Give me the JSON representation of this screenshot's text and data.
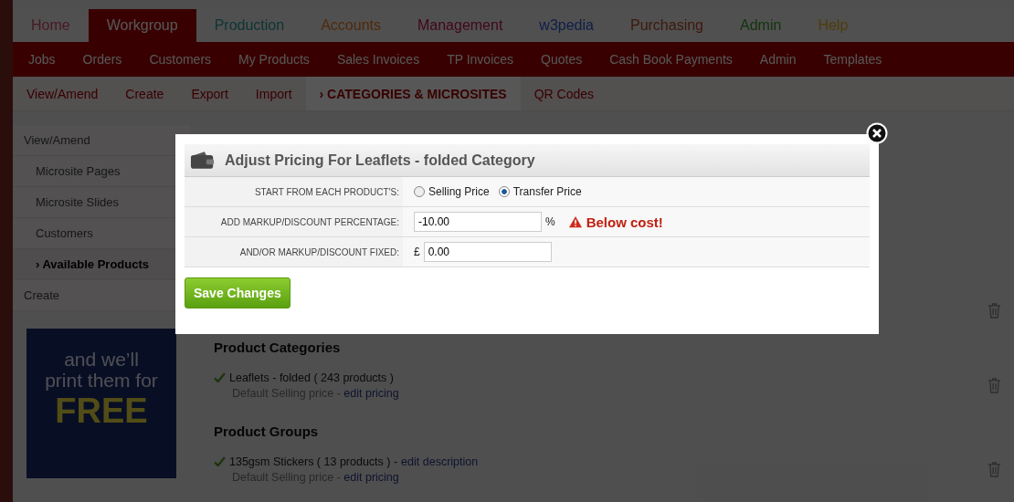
{
  "main_nav": [
    {
      "label": "Home",
      "selected": false
    },
    {
      "label": "Workgroup",
      "selected": true
    },
    {
      "label": "Production",
      "selected": false
    },
    {
      "label": "Accounts",
      "selected": false
    },
    {
      "label": "Management",
      "selected": false
    },
    {
      "label": "w3pedia",
      "selected": false
    },
    {
      "label": "Purchasing",
      "selected": false
    },
    {
      "label": "Admin",
      "selected": false
    },
    {
      "label": "Help",
      "selected": false
    }
  ],
  "sub_nav": [
    "Jobs",
    "Orders",
    "Customers",
    "My Products",
    "Sales Invoices",
    "TP Invoices",
    "Quotes",
    "Cash Book Payments",
    "Admin",
    "Templates"
  ],
  "section_nav": [
    {
      "label": "View/Amend",
      "selected": false
    },
    {
      "label": "Create",
      "selected": false
    },
    {
      "label": "Export",
      "selected": false
    },
    {
      "label": "Import",
      "selected": false
    },
    {
      "label": "› CATEGORIES & MICROSITES",
      "selected": true
    },
    {
      "label": "QR Codes",
      "selected": false
    }
  ],
  "sidebar": {
    "items": [
      {
        "label": "View/Amend",
        "selected": false,
        "children": [
          {
            "label": "Microsite Pages",
            "selected": false
          },
          {
            "label": "Microsite Slides",
            "selected": false
          },
          {
            "label": "Customers",
            "selected": false
          },
          {
            "label": "› Available Products",
            "selected": true
          }
        ]
      },
      {
        "label": "Create",
        "selected": false
      }
    ]
  },
  "banner": {
    "lines": [
      "and we’ll",
      "print them for"
    ],
    "highlight": "FREE"
  },
  "content": {
    "rows": [
      {
        "kind": "covered"
      },
      {
        "kind": "heading",
        "text": "Product Categories"
      },
      {
        "kind": "item",
        "name": "Leaflets - folded ( 243 products )",
        "detail": "Default Selling price -",
        "link": "edit pricing"
      },
      {
        "kind": "heading",
        "text": "Product Groups"
      },
      {
        "kind": "item",
        "name": "135gsm Stickers ( 13 products ) -",
        "action": "edit description",
        "detail": "Default Selling price -",
        "link": "edit pricing"
      }
    ]
  },
  "modal": {
    "title": "Adjust Pricing For Leaflets - folded Category",
    "fields": [
      {
        "kind": "radio",
        "label": "START FROM EACH PRODUCT'S:",
        "options": [
          {
            "label": "Selling Price",
            "selected": false
          },
          {
            "label": "Transfer Price",
            "selected": true
          }
        ]
      },
      {
        "kind": "input",
        "label": "ADD MARKUP/DISCOUNT PERCENTAGE:",
        "value": "-10.00",
        "suffix": "%",
        "warning": "Below cost!"
      },
      {
        "kind": "input",
        "label": "AND/OR MARKUP/DISCOUNT FIXED:",
        "prefix": "£",
        "value": "0.00"
      }
    ],
    "button": "Save Changes"
  }
}
